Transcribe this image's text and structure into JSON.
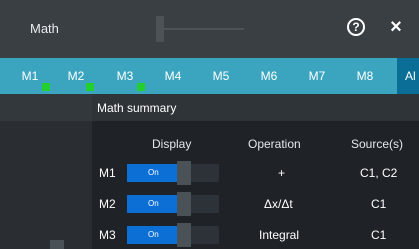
{
  "titlebar": {
    "title": "Math",
    "help_glyph": "?",
    "close_glyph": "×"
  },
  "tabs": [
    {
      "label": "M1",
      "active_marker": true
    },
    {
      "label": "M2",
      "active_marker": true
    },
    {
      "label": "M3",
      "active_marker": true
    },
    {
      "label": "M4",
      "active_marker": false
    },
    {
      "label": "M5",
      "active_marker": false
    },
    {
      "label": "M6",
      "active_marker": false
    },
    {
      "label": "M7",
      "active_marker": false
    },
    {
      "label": "M8",
      "active_marker": false
    }
  ],
  "active_tab": {
    "label": "Al"
  },
  "summary": {
    "title": "Math summary",
    "columns": {
      "display": "Display",
      "operation": "Operation",
      "sources": "Source(s)"
    },
    "rows": [
      {
        "label": "M1",
        "display": "On",
        "operation": "+",
        "sources": "C1, C2"
      },
      {
        "label": "M2",
        "display": "On",
        "operation": "Δx/Δt",
        "sources": "C1"
      },
      {
        "label": "M3",
        "display": "On",
        "operation": "Integral",
        "sources": "C1"
      }
    ]
  },
  "colors": {
    "tabbar": "#3ba5c0",
    "tab_active": "#0a6e96",
    "toggle_on": "#0c6fd6",
    "active_marker": "#22d12f"
  }
}
